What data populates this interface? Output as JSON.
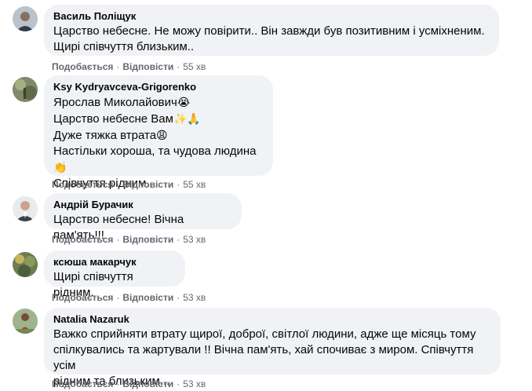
{
  "comments": [
    {
      "author": "Василь Поліщук",
      "lines": [
        "Царство небесне. Не можу повірити.. Він завжди був позитивним і усміхненим.",
        "Щирі співчуття близьким.."
      ],
      "like_label": "Подобається",
      "reply_label": "Відповісти",
      "time": "55 хв",
      "avatar_icon": "profile-photo-man"
    },
    {
      "author": "Ksy Kydryavceva-Grigorenko",
      "lines": [
        "Ярослав Миколайович",
        "Царство небесне Вам",
        "Дуже тяжка втрата",
        "Настільки хороша, та чудова людина",
        "Співчуття рідним..."
      ],
      "emojis": [
        "😭",
        "✨🙏",
        "😩",
        "👏"
      ],
      "like_label": "Подобається",
      "reply_label": "Відповісти",
      "time": "55 хв",
      "avatar_icon": "profile-photo-nature"
    },
    {
      "author": "Андрій Бурачик",
      "lines": [
        "Царство небесне! Вічна пам'ять!!!"
      ],
      "like_label": "Подобається",
      "reply_label": "Відповісти",
      "time": "53 хв",
      "avatar_icon": "profile-photo-man"
    },
    {
      "author": "ксюша макарчук",
      "lines": [
        "Щирі співчуття рідним."
      ],
      "like_label": "Подобається",
      "reply_label": "Відповісти",
      "time": "53 хв",
      "avatar_icon": "profile-photo-nature"
    },
    {
      "author": "Natalia Nazaruk",
      "lines": [
        "Важко сприйняти втрату щирої, доброї, світлої людини, адже ще місяць тому",
        "спілкувались та жартували !! Вічна пам'ять, хай спочиває з миром. Співчуття усім",
        "рідним та близьким..."
      ],
      "like_label": "Подобається",
      "reply_label": "Відповісти",
      "time": "53 хв",
      "avatar_icon": "profile-photo-woman"
    }
  ],
  "colors": {
    "bubble": "#f0f2f5",
    "text": "#050505",
    "secondary": "#65676b"
  }
}
